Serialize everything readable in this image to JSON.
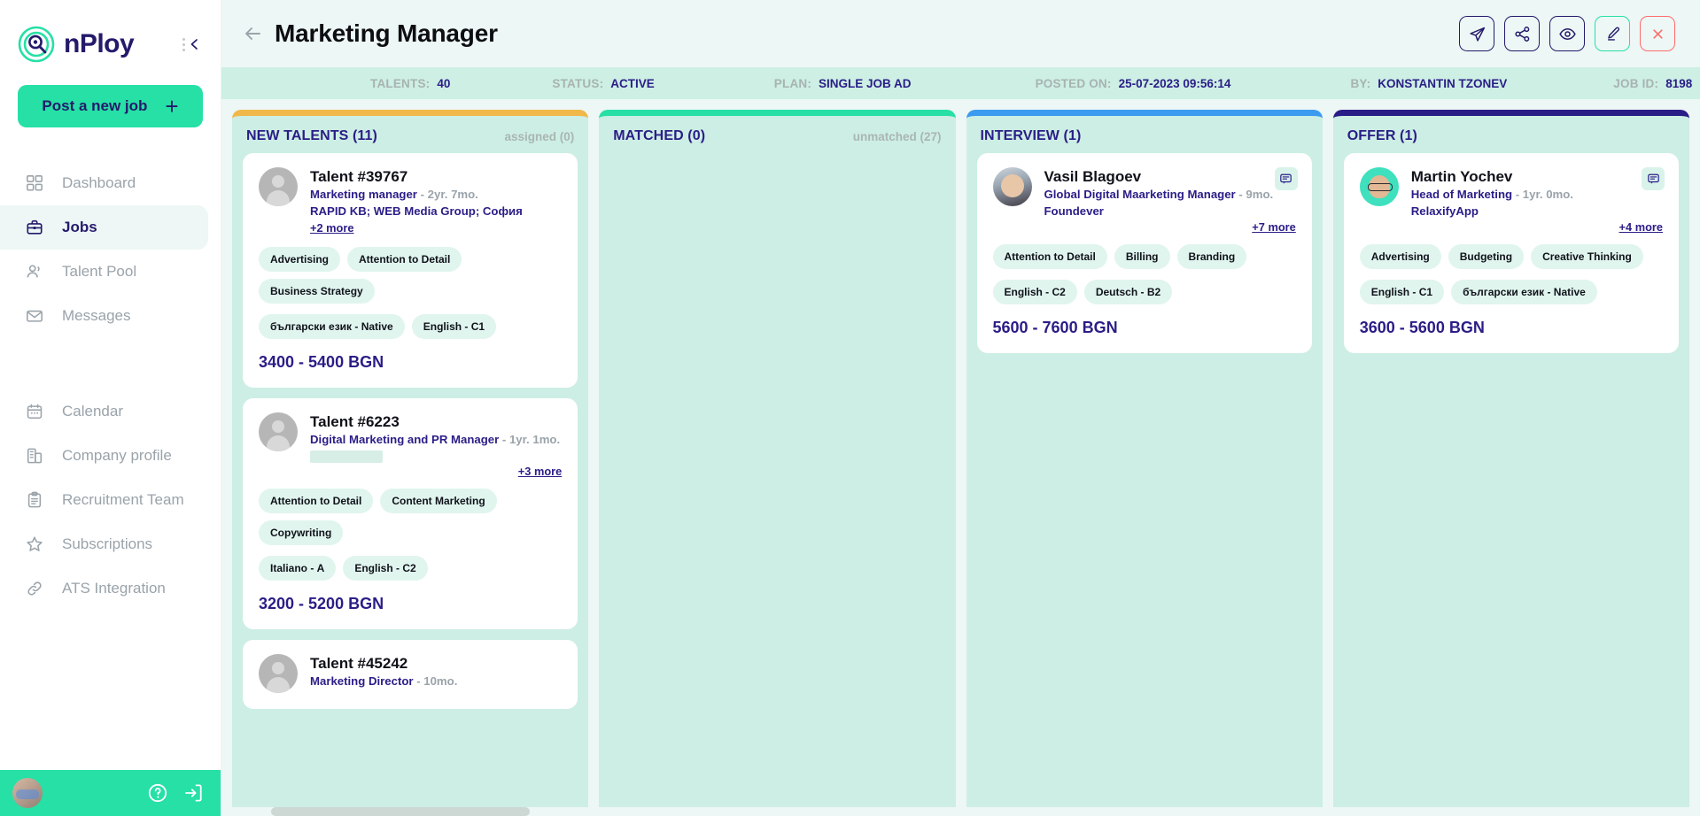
{
  "brand": {
    "name": "nPloy",
    "logo_icon": "nploy-target-logo",
    "collapse_icon": "collapse-chevron-icon"
  },
  "sidebar": {
    "post_button": {
      "label": "Post a new job",
      "icon": "plus-icon"
    },
    "items": [
      {
        "label": "Dashboard",
        "icon": "dashboard-grid-icon",
        "active": false
      },
      {
        "label": "Jobs",
        "icon": "briefcase-icon",
        "active": true
      },
      {
        "label": "Talent Pool",
        "icon": "people-icon",
        "active": false
      },
      {
        "label": "Messages",
        "icon": "envelope-icon",
        "active": false
      }
    ],
    "items_lower": [
      {
        "label": "Calendar",
        "icon": "calendar-icon",
        "active": false
      },
      {
        "label": "Company profile",
        "icon": "building-icon",
        "active": false
      },
      {
        "label": "Recruitment Team",
        "icon": "clipboard-icon",
        "active": false
      },
      {
        "label": "Subscriptions",
        "icon": "star-icon",
        "active": false
      },
      {
        "label": "ATS Integration",
        "icon": "link-icon",
        "active": false
      }
    ],
    "footer": {
      "avatar": "user-avatar",
      "help_icon": "question-circle-icon",
      "logout_icon": "logout-arrow-icon"
    }
  },
  "header": {
    "back_icon": "back-arrow-icon",
    "title": "Marketing Manager",
    "actions": [
      {
        "name": "send-button",
        "icon": "paper-plane-icon"
      },
      {
        "name": "share-button",
        "icon": "share-nodes-icon"
      },
      {
        "name": "preview-button",
        "icon": "eye-icon"
      },
      {
        "name": "edit-button",
        "icon": "pencil-icon"
      },
      {
        "name": "close-button",
        "icon": "close-x-icon"
      }
    ]
  },
  "meta": [
    {
      "label": "TALENTS:",
      "value": "40"
    },
    {
      "label": "STATUS:",
      "value": "ACTIVE"
    },
    {
      "label": "PLAN:",
      "value": "SINGLE JOB AD"
    },
    {
      "label": "POSTED ON:",
      "value": "25-07-2023 09:56:14"
    },
    {
      "label": "BY:",
      "value": "KONSTANTIN TZONEV"
    },
    {
      "label": "JOB ID:",
      "value": "8198"
    }
  ],
  "colors": {
    "accent_teal": "#26e0a6",
    "brand_navy": "#2a1d87",
    "column_new": "#f0b849",
    "column_matched": "#26e0a6",
    "column_interview": "#3b9bf0",
    "column_offer": "#2a1d87",
    "danger_red": "#ff6b6b"
  },
  "columns": [
    {
      "title": "NEW TALENTS (11)",
      "sub": "assigned (0)",
      "accent": "#f0b849",
      "cards": [
        {
          "name": "Talent #39767",
          "avatar": "placeholder",
          "role": "Marketing manager",
          "duration": "- 2yr. 7mo.",
          "company": "RAPID KB; WEB Media Group; София",
          "more": "+2 more",
          "more_position": "left",
          "has_message_button": false,
          "redacted": false,
          "skills": [
            "Advertising",
            "Attention to Detail",
            "Business Strategy"
          ],
          "languages": [
            "български език - Native",
            "English - C1"
          ],
          "salary": "3400 - 5400 BGN"
        },
        {
          "name": "Talent #6223",
          "avatar": "placeholder",
          "role": "Digital Marketing and PR Manager",
          "duration": "- 1yr. 1mo.",
          "company": "",
          "more": "+3 more",
          "more_position": "right",
          "has_message_button": false,
          "redacted": true,
          "skills": [
            "Attention to Detail",
            "Content Marketing",
            "Copywriting"
          ],
          "languages": [
            "Italiano - A",
            "English - C2"
          ],
          "salary": "3200 - 5200 BGN"
        },
        {
          "name": "Talent #45242",
          "avatar": "placeholder",
          "role": "Marketing Director",
          "duration": "- 10mo.",
          "company": "",
          "more": "",
          "more_position": "left",
          "has_message_button": false,
          "redacted": false,
          "skills": [],
          "languages": [],
          "salary": ""
        }
      ]
    },
    {
      "title": "MATCHED (0)",
      "sub": "unmatched (27)",
      "accent": "#26e0a6",
      "cards": []
    },
    {
      "title": "INTERVIEW (1)",
      "sub": "",
      "accent": "#3b9bf0",
      "cards": [
        {
          "name": "Vasil Blagoev",
          "avatar": "photo1",
          "role": "Global Digital Maarketing Manager",
          "duration": "- 9mo.",
          "company": "Foundever",
          "more": "+7 more",
          "more_position": "right",
          "has_message_button": true,
          "redacted": false,
          "skills": [
            "Attention to Detail",
            "Billing",
            "Branding"
          ],
          "languages": [
            "English - C2",
            "Deutsch - B2"
          ],
          "salary": "5600 - 7600 BGN"
        }
      ]
    },
    {
      "title": "OFFER (1)",
      "sub": "",
      "accent": "#2a1d87",
      "cards": [
        {
          "name": "Martin Yochev",
          "avatar": "photo2",
          "role": "Head of Marketing",
          "duration": "- 1yr. 0mo.",
          "company": "RelaxifyApp",
          "more": "+4 more",
          "more_position": "right",
          "has_message_button": true,
          "redacted": false,
          "skills": [
            "Advertising",
            "Budgeting",
            "Creative Thinking"
          ],
          "languages": [
            "English - C1",
            "български език - Native"
          ],
          "salary": "3600 - 5600 BGN"
        }
      ]
    }
  ]
}
